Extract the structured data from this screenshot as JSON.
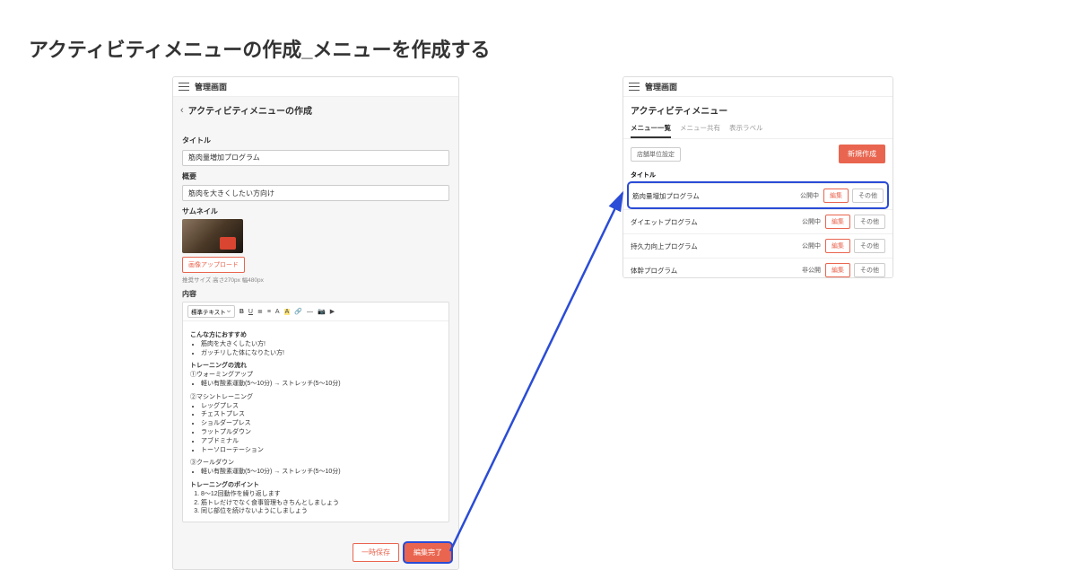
{
  "page_title": "アクティビティメニューの作成_メニューを作成する",
  "left": {
    "app_title": "管理画面",
    "sub_title": "アクティビティメニューの作成",
    "field_title_label": "タイトル",
    "field_title_value": "筋肉量増加プログラム",
    "field_summary_label": "概要",
    "field_summary_value": "筋肉を大きくしたい方向け",
    "field_thumb_label": "サムネイル",
    "upload_btn": "画像アップロード",
    "size_hint": "推奨サイズ 高さ270px 幅480px",
    "field_content_label": "内容",
    "editor_select": "標準テキスト",
    "content": {
      "h1": "こんな方におすすめ",
      "ul1": [
        "筋肉を大きくしたい方!",
        "ガッチリした体になりたい方!"
      ],
      "h2": "トレーニングの流れ",
      "s1": "①ウォーミングアップ",
      "ul2": [
        "軽い有酸素運動(5〜10分) → ストレッチ(5〜10分)"
      ],
      "s2": "②マシントレーニング",
      "ul3": [
        "レッグプレス",
        "チェストプレス",
        "ショルダープレス",
        "ラットプルダウン",
        "アブドミナル",
        "トーソローテーション"
      ],
      "s3": "③クールダウン",
      "ul4": [
        "軽い有酸素運動(5〜10分) → ストレッチ(5〜10分)"
      ],
      "h3": "トレーニングのポイント",
      "ol": [
        "8〜12回動作を繰り返します",
        "筋トレだけでなく食事管理もきちんとしましょう",
        "同じ部位を続けないようにしましょう"
      ]
    },
    "btn_draft": "一時保存",
    "btn_done": "編集完了"
  },
  "right": {
    "app_title": "管理画面",
    "sub_title": "アクティビティメニュー",
    "tabs": [
      "メニュー一覧",
      "メニュー共有",
      "表示ラベル"
    ],
    "btn_store": "店舗単位設定",
    "btn_new": "新規作成",
    "col_title": "タイトル",
    "rows": [
      {
        "title": "筋肉量増加プログラム",
        "status": "公開中"
      },
      {
        "title": "ダイエットプログラム",
        "status": "公開中"
      },
      {
        "title": "持久力向上プログラム",
        "status": "公開中"
      },
      {
        "title": "体幹プログラム",
        "status": "非公開"
      }
    ],
    "btn_edit": "編集",
    "btn_other": "その他"
  }
}
